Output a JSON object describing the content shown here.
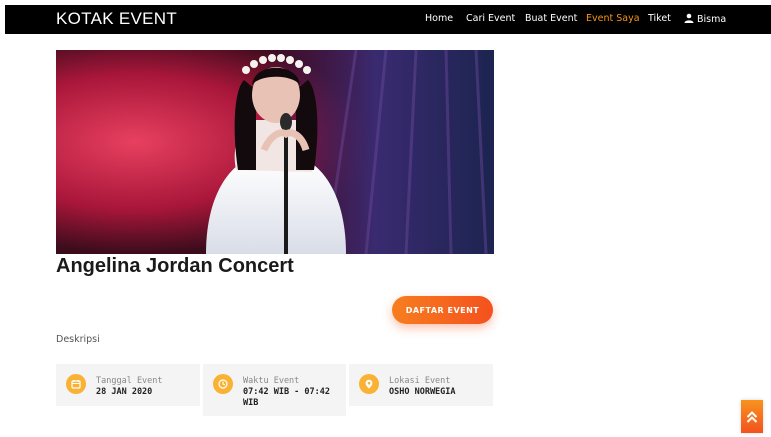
{
  "brand": "KOTAK EVENT",
  "nav": {
    "home": "Home",
    "cari_event": "Cari Event",
    "buat_event": "Buat Event",
    "event_saya": "Event Saya",
    "tiket": "Tiket",
    "user": "Bisma"
  },
  "colors": {
    "accent": "#f7941d",
    "button_gradient_start": "#f77e1f",
    "button_gradient_end": "#f4511e",
    "icon_yellow": "#f9b233"
  },
  "event": {
    "title": "Angelina Jordan Concert",
    "register_button": "DAFTAR EVENT",
    "description_label": "Deskripsi"
  },
  "info": {
    "date": {
      "icon": "calendar-icon",
      "label": "Tanggal Event",
      "value": "28 JAN 2020"
    },
    "time": {
      "icon": "clock-icon",
      "label": "Waktu Event",
      "value": "07:42 WIB - 07:42 WIB"
    },
    "location": {
      "icon": "location-pin-icon",
      "label": "Lokasi Event",
      "value": "OSHO NORWEGIA"
    }
  },
  "scroll_top_icon": "double-chevron-up-icon"
}
